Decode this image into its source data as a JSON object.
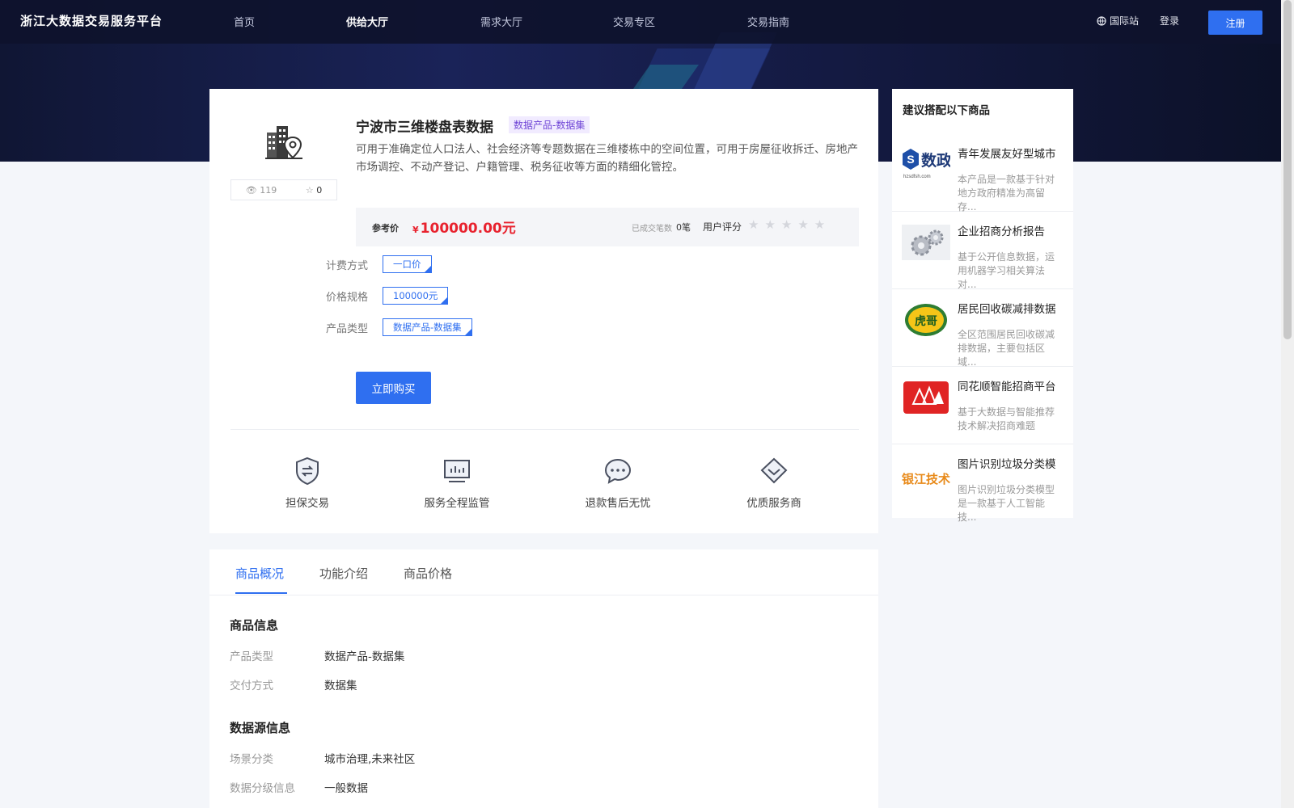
{
  "header": {
    "brand": "浙江大数据交易服务平台",
    "nav": [
      {
        "label": "首页",
        "active": false
      },
      {
        "label": "供给大厅",
        "active": true
      },
      {
        "label": "需求大厅",
        "active": false
      },
      {
        "label": "交易专区",
        "active": false
      },
      {
        "label": "交易指南",
        "active": false
      }
    ],
    "intl_label": "国际站",
    "login_label": "登录",
    "register_label": "注册"
  },
  "product": {
    "title": "宁波市三维楼盘表数据",
    "tag": "数据产品-数据集",
    "description": "可用于准确定位人口法人、社会经济等专题数据在三维楼栋中的空间位置，可用于房屋征收拆迁、房地产市场调控、不动产登记、户籍管理、税务征收等方面的精细化管控。",
    "views": "119",
    "favorites": "0",
    "ref_price_label": "参考价",
    "currency_symbol": "¥",
    "price": "100000.00元",
    "deals_label": "已成交笔数",
    "deals_value": "0笔",
    "rating_label": "用户评分",
    "rating_stars": "★★★★★",
    "rating_value": 0,
    "options": [
      {
        "label": "计费方式",
        "value": "一口价"
      },
      {
        "label": "价格规格",
        "value": "100000元"
      },
      {
        "label": "产品类型",
        "value": "数据产品-数据集"
      }
    ],
    "buy_label": "立即购买",
    "features": [
      {
        "label": "担保交易",
        "icon": "shield-icon"
      },
      {
        "label": "服务全程监管",
        "icon": "monitor-icon"
      },
      {
        "label": "退款售后无忧",
        "icon": "chat-icon"
      },
      {
        "label": "优质服务商",
        "icon": "diamond-icon"
      }
    ]
  },
  "tabs": [
    "商品概况",
    "功能介绍",
    "商品价格"
  ],
  "details": {
    "product_info_title": "商品信息",
    "product_info": [
      {
        "key": "产品类型",
        "value": "数据产品-数据集"
      },
      {
        "key": "交付方式",
        "value": "数据集"
      }
    ],
    "source_info_title": "数据源信息",
    "source_info": [
      {
        "key": "场景分类",
        "value": "城市治理,未来社区"
      },
      {
        "key": "数据分级信息",
        "value": "一般数据"
      }
    ]
  },
  "sidebar": {
    "title": "建议搭配以下商品",
    "items": [
      {
        "name": "青年发展友好型城市",
        "desc": "本产品是一款基于针对地方政府精准为高留存...",
        "logo_text": "数政",
        "logo_sub": "hzsdfsh.com"
      },
      {
        "name": "企业招商分析报告",
        "desc": "基于公开信息数据，运用机器学习相关算法对...",
        "logo_text": "",
        "logo_sub": ""
      },
      {
        "name": "居民回收碳减排数据",
        "desc": "全区范围居民回收碳减排数据，主要包括区域...",
        "logo_text": "虎哥",
        "logo_sub": ""
      },
      {
        "name": "同花顺智能招商平台",
        "desc": "基于大数据与智能推荐技术解决招商难题",
        "logo_text": "",
        "logo_sub": ""
      },
      {
        "name": "图片识别垃圾分类模",
        "desc": "图片识别垃圾分类模型是一款基于人工智能技...",
        "logo_text": "银江技术",
        "logo_sub": ""
      }
    ]
  },
  "colors": {
    "accent": "#2f6ff0",
    "price": "#e8222e",
    "tag": "#6f45d6",
    "header_bg": "#101634"
  }
}
